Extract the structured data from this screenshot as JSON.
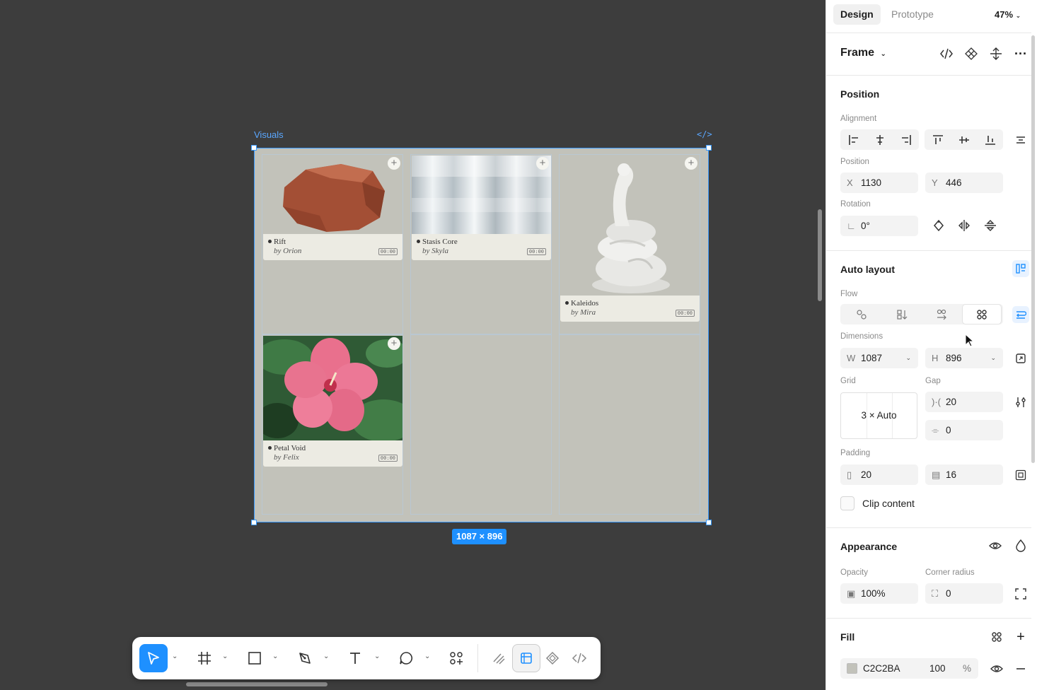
{
  "canvas": {
    "frame_name": "Visuals",
    "code_badge": "</>",
    "size_badge": "1087 × 896",
    "cards": [
      {
        "title": "Rift",
        "author": "by Orion",
        "time": "00:00"
      },
      {
        "title": "Stasis Core",
        "author": "by Skyla",
        "time": "00:00"
      },
      {
        "title": "Kaleidos",
        "author": "by Mira",
        "time": "00:00"
      },
      {
        "title": "Petal Void",
        "author": "by Felix",
        "time": "00:00"
      }
    ],
    "add_symbol": "+"
  },
  "toolbar": {
    "tools": [
      "move-tool",
      "frame-tool",
      "shape-tool",
      "pen-tool",
      "text-tool",
      "comment-tool",
      "actions-tool",
      "draw-mode",
      "design-mode",
      "prototype-mode",
      "dev-mode"
    ],
    "active_tool": "move-tool"
  },
  "panel": {
    "tabs": [
      "Design",
      "Prototype"
    ],
    "active_tab": "Design",
    "zoom": "47%",
    "selection": "Frame",
    "position": {
      "title": "Position",
      "alignment_label": "Alignment",
      "position_label": "Position",
      "x_label": "X",
      "x": "1130",
      "y_label": "Y",
      "y": "446",
      "rotation_label": "Rotation",
      "rotation": "0°"
    },
    "auto_layout": {
      "title": "Auto layout",
      "flow_label": "Flow",
      "dimensions_label": "Dimensions",
      "w_label": "W",
      "w": "1087",
      "h_label": "H",
      "h": "896",
      "grid_label": "Grid",
      "grid_value": "3 × Auto",
      "gap_label": "Gap",
      "gap_h": "20",
      "gap_v": "0",
      "padding_label": "Padding",
      "padding_h": "20",
      "padding_v": "16",
      "clip_label": "Clip content"
    },
    "appearance": {
      "title": "Appearance",
      "opacity_label": "Opacity",
      "opacity": "100%",
      "radius_label": "Corner radius",
      "radius": "0"
    },
    "fill": {
      "title": "Fill",
      "hex": "C2C2BA",
      "opacity": "100",
      "percent": "%"
    }
  },
  "colors": {
    "canvas_bg": "#3d3d3d",
    "frame_fill": "#c2c2ba",
    "accent": "#1e90ff"
  }
}
